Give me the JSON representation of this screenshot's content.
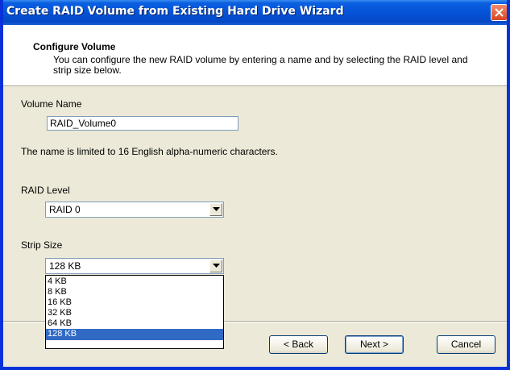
{
  "window": {
    "title": "Create RAID Volume from Existing Hard Drive Wizard"
  },
  "header": {
    "title": "Configure Volume",
    "description": "You can configure the new RAID volume by entering a name and by selecting the RAID level and strip size below."
  },
  "volume_name": {
    "label": "Volume Name",
    "value": "RAID_Volume0",
    "hint": "The name is limited to 16 English alpha-numeric characters."
  },
  "raid_level": {
    "label": "RAID Level",
    "selected": "RAID 0"
  },
  "strip_size": {
    "label": "Strip Size",
    "selected": "128 KB",
    "options": [
      "4 KB",
      "8 KB",
      "16 KB",
      "32 KB",
      "64 KB",
      "128 KB"
    ]
  },
  "buttons": {
    "back": "< Back",
    "next": "Next >",
    "cancel": "Cancel"
  },
  "icons": {
    "close": "close-icon",
    "dropdown": "chevron-down-icon"
  },
  "colors": {
    "title_bar": "#0553d8",
    "window_border": "#0831d9",
    "close_button": "#e05a34",
    "selection": "#316ac5",
    "dialog_bg": "#ece9d8"
  }
}
